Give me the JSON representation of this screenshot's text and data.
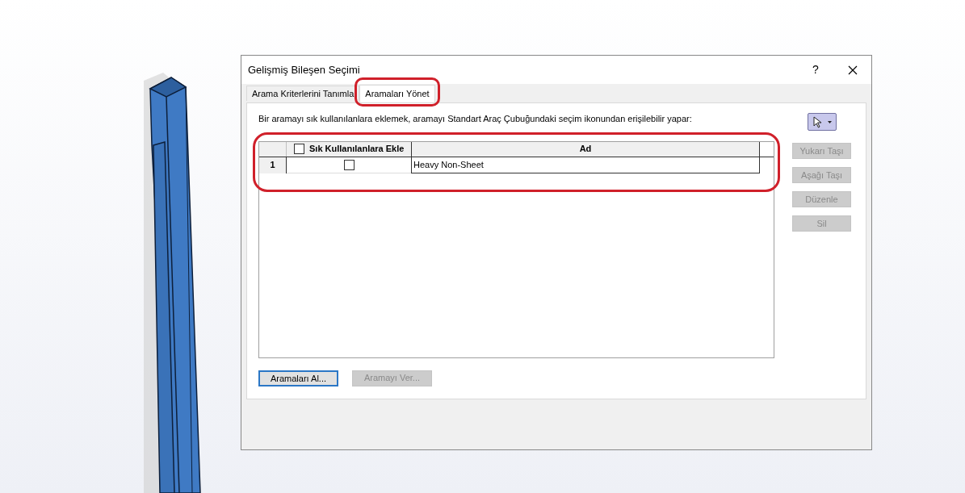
{
  "window": {
    "title": "Gelişmiş Bileşen Seçimi",
    "help": "?"
  },
  "tabs": [
    {
      "label": "Arama Kriterlerini Tanımla",
      "selected": false,
      "highlighted": false
    },
    {
      "label": "Aramaları Yönet",
      "selected": true,
      "highlighted": true
    }
  ],
  "description": "Bir aramayı sık kullanılanlara eklemek, aramayı Standart Araç Çubuğundaki seçim ikonundan erişilebilir yapar:",
  "table": {
    "highlighted": true,
    "header_checkbox": {
      "checked": false
    },
    "columns": [
      "Sık Kullanılanlara Ekle",
      "Ad"
    ],
    "rows": [
      {
        "number": "1",
        "checked": false,
        "name": "Heavy Non-Sheet"
      }
    ]
  },
  "side_buttons": [
    {
      "label": "Yukarı Taşı",
      "disabled": true
    },
    {
      "label": "Aşağı Taşı",
      "disabled": true
    },
    {
      "label": "Düzenle",
      "disabled": true
    },
    {
      "label": "Sil",
      "disabled": true
    }
  ],
  "bottom_buttons": [
    {
      "label": "Aramaları Al...",
      "disabled": false
    },
    {
      "label": "Aramayı Ver...",
      "disabled": true
    }
  ]
}
